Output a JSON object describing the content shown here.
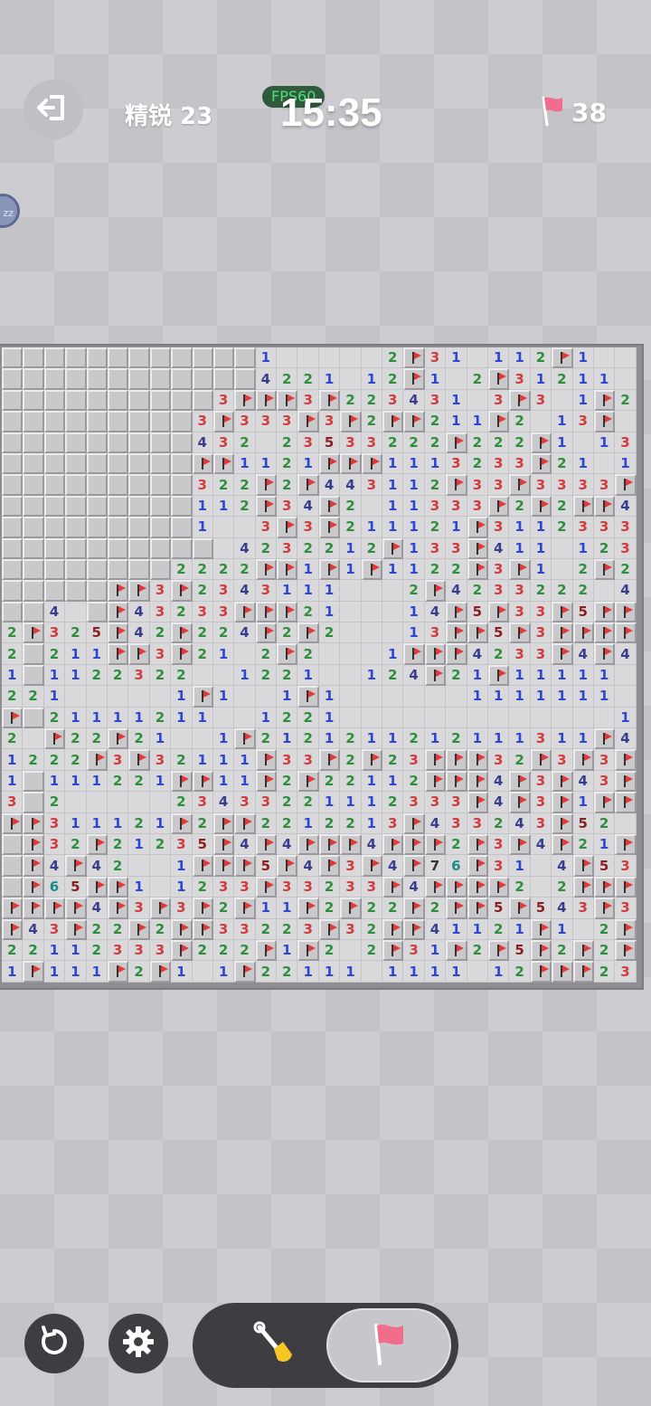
{
  "header": {
    "level_label": "精锐 23",
    "fps_label": "FPS60",
    "timer": "15:35",
    "flags_remaining": "38",
    "side_badge": "zz"
  },
  "icons": {
    "exit": "exit-icon",
    "flag": "flag-icon",
    "restart": "restart-icon",
    "settings": "gear-icon",
    "dig": "shovel-icon"
  },
  "colors": {
    "number_1": "#2e47d3",
    "number_2": "#2e8f3a",
    "number_3": "#d23c3c",
    "number_4": "#3a3d8e",
    "number_5": "#8a1f1f",
    "number_6": "#1a8a8a",
    "flag": "#e23a3a"
  },
  "board": {
    "rows": 30,
    "cols": 30,
    "legend": "#=covered, F=flag, .=opened empty, digits=adjacent mines",
    "cells": [
      "############1.....2F31.112F1..",
      "############4221.12F1.2F31211",
      "##########3FFF3F223431.3F3.1F2",
      "#########3F333F3F2FF211F2.13F",
      "#########432.23533222F222F1.13F",
      "#########FF1121FFF1113233F21.1F3",
      "#########322F2F443112F33F3333F3",
      "#########112F34F2.11333F2F2FF43",
      "#########1..3F3F211121F3112333F3",
      "##########.4232212F133F411.1232",
      "########2222FF1F1F1122F3F1.2F2.",
      "#####FF3F2343111...2F4233222.4F52",
      "##4.#F43233FFF21...14F5F33F5FFFF",
      "2F325F42F224F2F2...13FF5F3FFFFF42",
      "2#211FF3F21.2F2...1FFF4233F4F421",
      "1#1122322..1221..124F21F11111.",
      "221.....1F1..1F1......1111111...",
      "F#21111211..1221.............11112",
      "2.F22F21..1F2121211212111311F43F3F",
      "1222F3F32111F33F2F23FFF32F3F3FF32",
      "1#111221FF11F2F22112FFF4F3F43F32",
      "3#2.....23433221112333F4F3F1FF11",
      "FF311121F2FF2212213F433243F52",
      "#F32F21235F4F4FFF4FFF2F3F4F21FF",
      "#F4F42..1FFF5F4F3F4F76F31.4F5332",
      "#F65FF1.1233F33233F4FFFF2.2FFF1.",
      "FFFF4F3F3F2F11F2F22F2FF5F543F3F2",
      "F43F22F2FF33223F32FF41121F1.2F31",
      "22112333F222F1F2.2F31F2F5F2F2F2",
      "1F111F2F1.1F22111.1111.12FFF23F2"
    ]
  }
}
